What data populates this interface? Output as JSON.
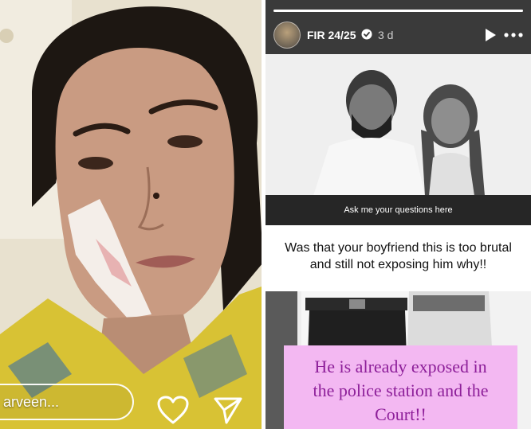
{
  "left_story": {
    "reply_placeholder": "arveen...",
    "icons": {
      "like": "heart-icon",
      "share": "send-icon"
    }
  },
  "right_story": {
    "username": "FIR 24/25",
    "timestamp": "3 d",
    "icons": {
      "verified": "verified-badge-icon",
      "play": "play-icon",
      "more": "more-options-icon"
    },
    "progress_fraction": 1.0,
    "question_header": "Ask me your questions here",
    "question_lines": [
      "Was that your boyfriend this is too brutal",
      "and still not exposing him why!!"
    ],
    "answer_lines": [
      "He is already exposed in",
      "the police station and the",
      "Court!!"
    ],
    "colors": {
      "question_header_bg": "#262626",
      "answer_bg": "#f3b8f2",
      "answer_text": "#8d1f99"
    }
  }
}
